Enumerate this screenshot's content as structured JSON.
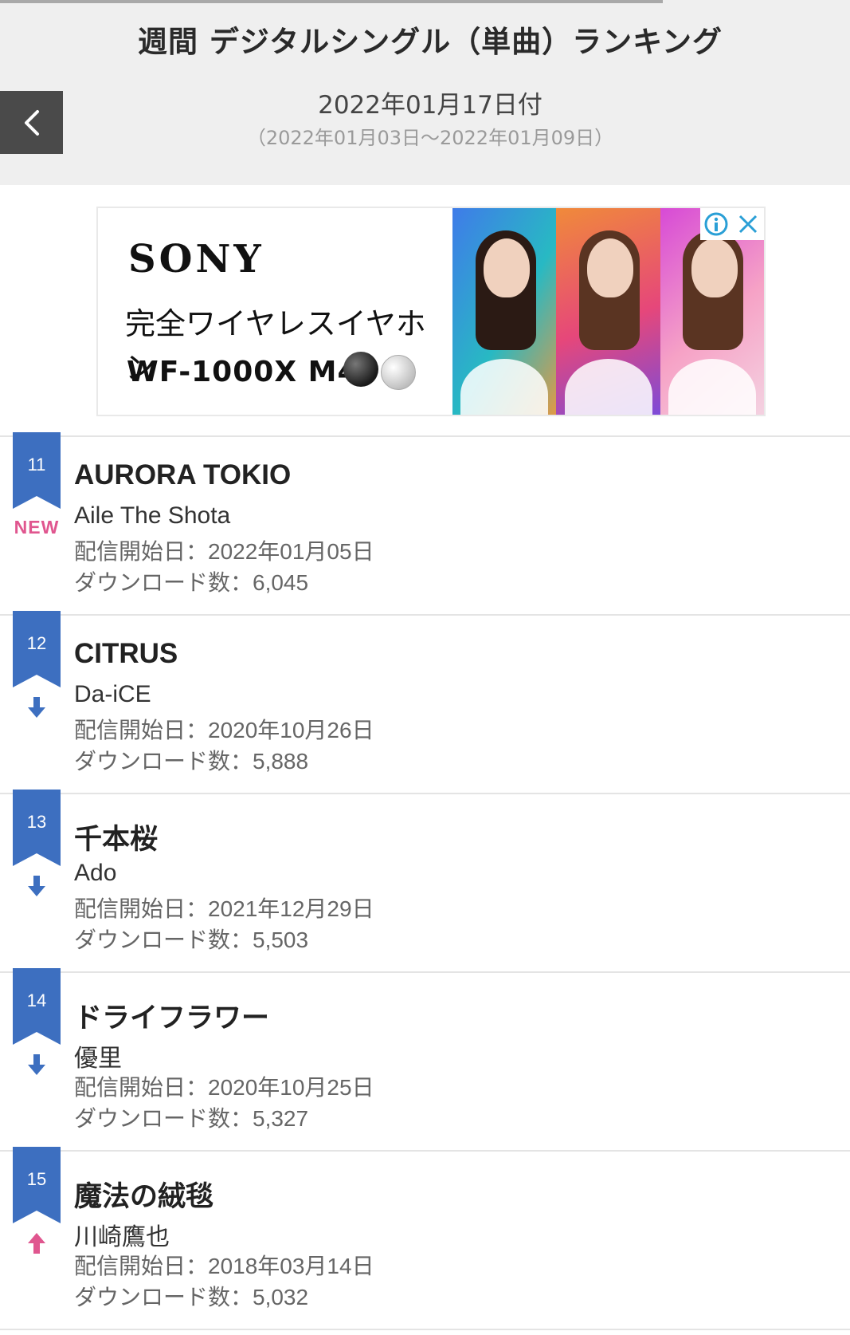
{
  "header": {
    "title": "週間 デジタルシングル（単曲）ランキング",
    "issue_date": "2022年01月17日付",
    "period": "（2022年01月03日～2022年01月09日）",
    "back_icon": "chevron-left-icon",
    "progress_percent": 78
  },
  "ad": {
    "brand": "SONY",
    "tagline": "完全ワイヤレスイヤホン",
    "model": "WF-1000X M4",
    "info_icon": "info-icon",
    "close_icon": "close-icon"
  },
  "ranking": [
    {
      "rank": "11",
      "title": "AURORA TOKIO",
      "artist": "Aile The Shota",
      "release": "配信開始日：2022年01月05日",
      "downloads": "ダウンロード数：6,045",
      "movement": "new",
      "movement_label": "NEW"
    },
    {
      "rank": "12",
      "title": "CITRUS",
      "artist": "Da-iCE",
      "release": "配信開始日：2020年10月26日",
      "downloads": "ダウンロード数：5,888",
      "movement": "down"
    },
    {
      "rank": "13",
      "title": "千本桜",
      "artist": "Ado",
      "release": "配信開始日：2021年12月29日",
      "downloads": "ダウンロード数：5,503",
      "movement": "down"
    },
    {
      "rank": "14",
      "title": "ドライフラワー",
      "artist": "優里",
      "release": "配信開始日：2020年10月25日",
      "downloads": "ダウンロード数：5,327",
      "movement": "down"
    },
    {
      "rank": "15",
      "title": "魔法の絨毯",
      "artist": "川崎鷹也",
      "release": "配信開始日：2018年03月14日",
      "downloads": "ダウンロード数：5,032",
      "movement": "up"
    }
  ],
  "colors": {
    "badge": "#3d6fc0",
    "down_arrow": "#3d6fc0",
    "up_arrow": "#e0568f",
    "new_label": "#e0568f",
    "header_bg": "#efefef",
    "back_button_bg": "#4a4a4a"
  }
}
